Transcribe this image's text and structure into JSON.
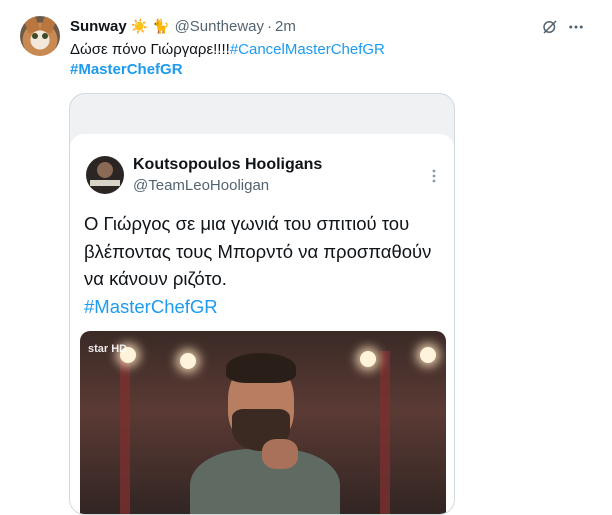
{
  "tweet": {
    "display_name": "Sunway",
    "emojis": {
      "sun": "☀️",
      "cat": "🐈"
    },
    "handle": "@Suntheway",
    "separator": "·",
    "time": "2m",
    "text_main": "Δώσε πόνο Γιώργαρε!!!!",
    "hashtag_inline": "#CancelMasterChefGR",
    "hashtag_line": "#MasterChefGR",
    "icons": [
      "grok-icon",
      "more-options-icon"
    ]
  },
  "quoted_screenshot": {
    "display_name": "Koutsopoulos Hooligans",
    "handle": "@TeamLeoHooligan",
    "text": "Ο Γιώργος σε μια γωνιά του σπιτιού του βλέποντας τους Μπορντό να προσπαθούν να κάνουν ριζότο.",
    "hashtag": "#MasterChefGR",
    "photo_logo": "star HD"
  },
  "colors": {
    "text": "#0f1419",
    "secondary": "#536471",
    "link": "#1d9bf0",
    "border": "#cfd9de"
  }
}
